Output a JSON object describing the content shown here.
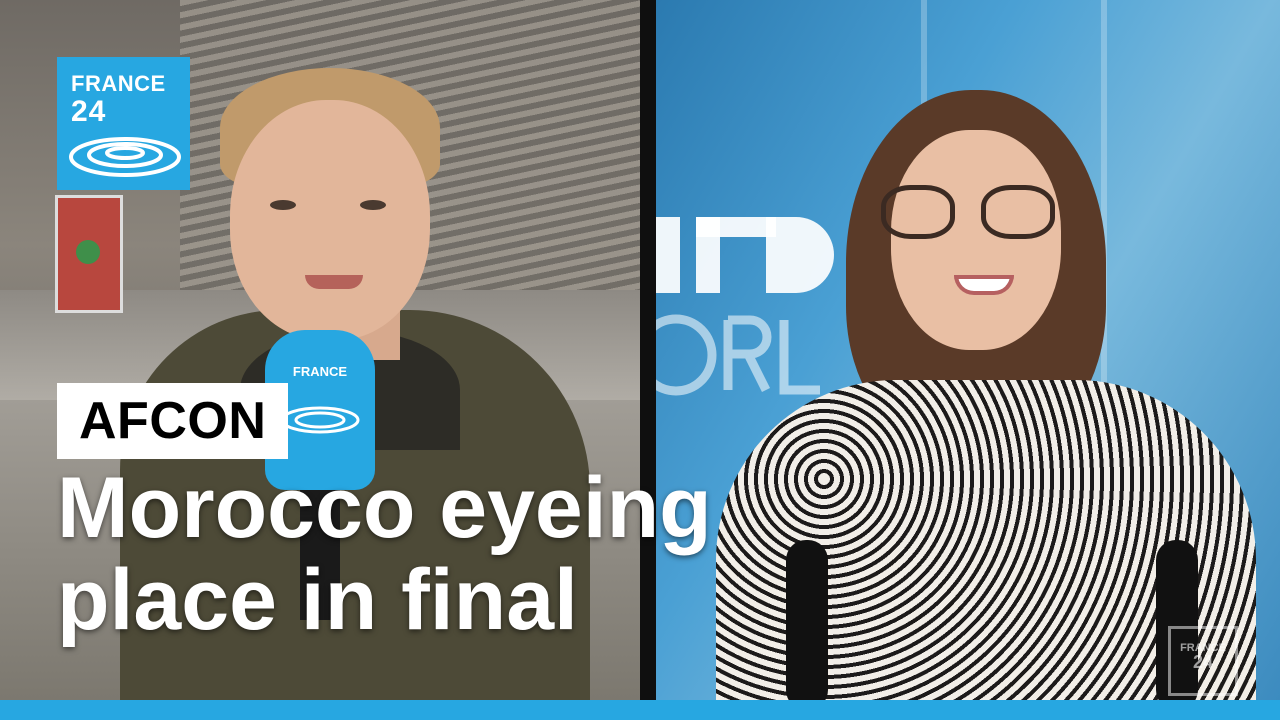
{
  "logo": {
    "line1": "FRANCE",
    "line2": "24",
    "color": "#27a7e1"
  },
  "mic_logo": "FRANCE",
  "caption": {
    "tag": "AFCON",
    "headline_line1": "Morocco eyeing",
    "headline_line2": "place in final"
  },
  "studio_logo": {
    "line1": "FRANCE",
    "line2": "24"
  },
  "colors": {
    "accent": "#27a7e1",
    "caption_box": "#ffffff",
    "headline_text": "#ffffff"
  }
}
